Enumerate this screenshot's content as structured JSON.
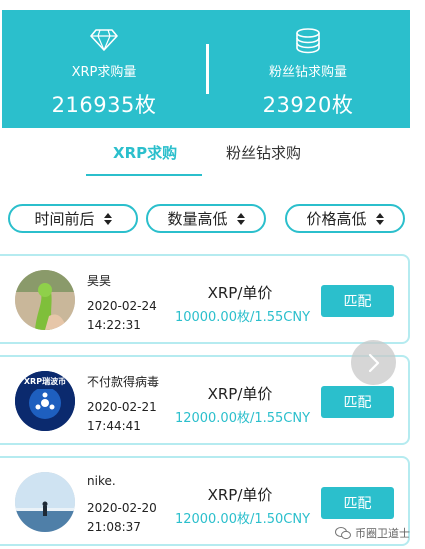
{
  "header": {
    "xrp": {
      "label": "XRP求购量",
      "value": "216935枚",
      "icon": "diamond-icon"
    },
    "fans": {
      "label": "粉丝钻求购量",
      "value": "23920枚",
      "icon": "coin-stack-icon"
    }
  },
  "tabs": [
    {
      "label": "XRP求购",
      "active": true
    },
    {
      "label": "粉丝钻求购",
      "active": false
    }
  ],
  "sort": [
    {
      "label": "时间前后"
    },
    {
      "label": "数量高低"
    },
    {
      "label": "价格高低"
    }
  ],
  "orders": [
    {
      "name": "昊昊",
      "date": "2020-02-24",
      "time": "14:22:31",
      "unit": "XRP/单价",
      "price": "10000.00枚/1.55CNY",
      "action": "匹配"
    },
    {
      "name": "不付款得病毒",
      "date": "2020-02-21",
      "time": "17:44:41",
      "unit": "XRP/单价",
      "price": "12000.00枚/1.55CNY",
      "action": "匹配",
      "avatar_text": "XRP瑞波币"
    },
    {
      "name": "nike.",
      "date": "2020-02-20",
      "time": "21:08:37",
      "unit": "XRP/单价",
      "price": "12000.00枚/1.50CNY",
      "action": "匹配"
    }
  ],
  "watermark": {
    "text": "币圈卫道士"
  },
  "colors": {
    "accent": "#2bbfcc",
    "card_border": "#b5ebf0"
  }
}
